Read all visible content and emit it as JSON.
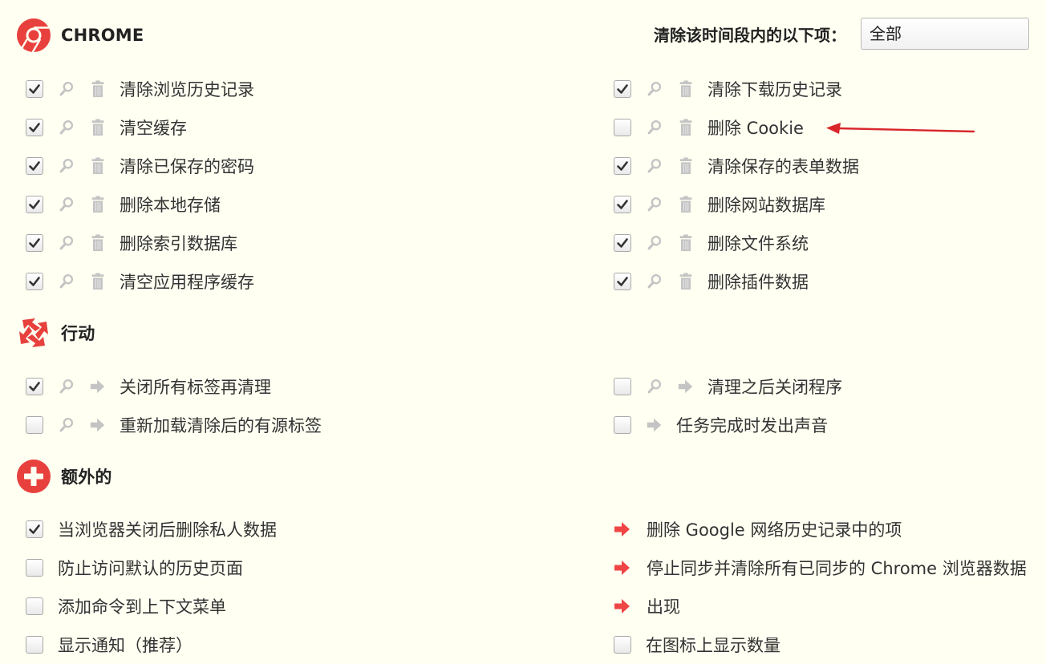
{
  "chrome_section": {
    "title": "CHROME",
    "icon": "chrome-logo-icon",
    "timerange": {
      "label": "清除该时间段内的以下项：",
      "value": "全部"
    },
    "items": [
      {
        "label": "清除浏览历史记录",
        "checked": true
      },
      {
        "label": "清除下载历史记录",
        "checked": true
      },
      {
        "label": "清空缓存",
        "checked": true
      },
      {
        "label": "删除 Cookie",
        "checked": false
      },
      {
        "label": "清除已保存的密码",
        "checked": true
      },
      {
        "label": "清除保存的表单数据",
        "checked": true
      },
      {
        "label": "删除本地存储",
        "checked": true
      },
      {
        "label": "删除网站数据库",
        "checked": true
      },
      {
        "label": "删除索引数据库",
        "checked": true
      },
      {
        "label": "删除文件系统",
        "checked": true
      },
      {
        "label": "清空应用程序缓存",
        "checked": true
      },
      {
        "label": "删除插件数据",
        "checked": true
      }
    ]
  },
  "action_section": {
    "title": "行动",
    "icon": "recycle-arrows-icon",
    "items": [
      {
        "label": "关闭所有标签再清理",
        "checked": true
      },
      {
        "label": "清理之后关闭程序",
        "checked": false
      },
      {
        "label": "重新加载清除后的有源标签",
        "checked": false
      },
      {
        "label": "任务完成时发出声音",
        "checked": false
      }
    ]
  },
  "extra_section": {
    "title": "额外的",
    "icon": "plus-circle-icon",
    "left_items": [
      {
        "label": "当浏览器关闭后删除私人数据",
        "checked": true
      },
      {
        "label": "防止访问默认的历史页面",
        "checked": false
      },
      {
        "label": "添加命令到上下文菜单",
        "checked": false
      },
      {
        "label": "显示通知（推荐）",
        "checked": false
      }
    ],
    "right_links": [
      {
        "label": "删除 Google 网络历史记录中的项"
      },
      {
        "label": "停止同步并清除所有已同步的 Chrome 浏览器数据"
      },
      {
        "label": "出现"
      }
    ],
    "right_checkbox": {
      "label": "在图标上显示数量",
      "checked": false
    }
  },
  "colors": {
    "background": "#fffff2",
    "accent_red": "#e8413d",
    "icon_grey": "#c4c4c4",
    "annotation_red": "#d9262b"
  }
}
